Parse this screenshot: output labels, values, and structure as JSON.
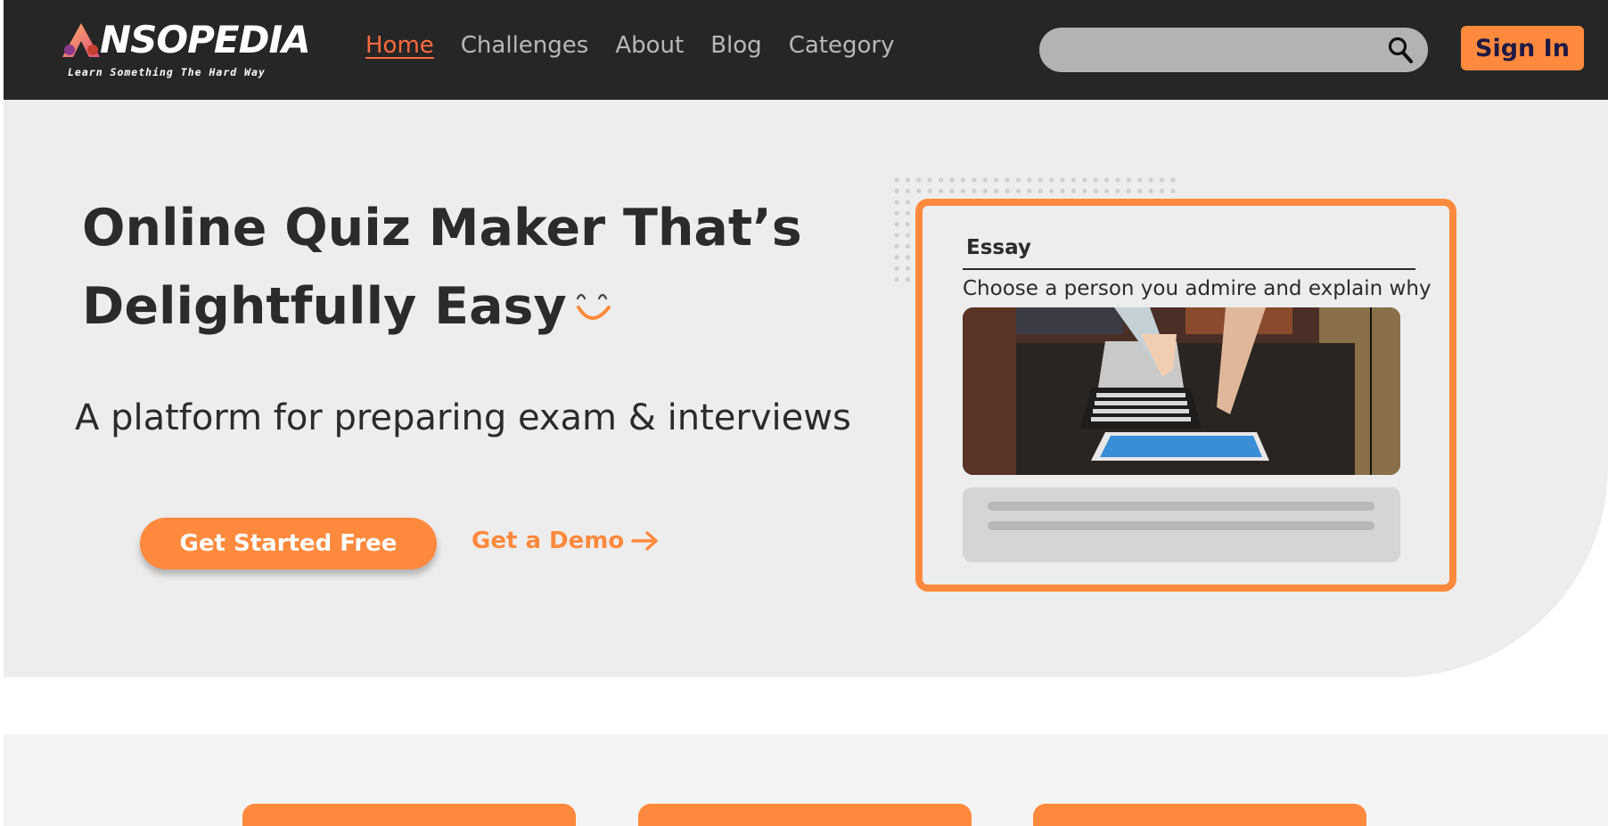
{
  "brand": {
    "name": "NSOPEDIA",
    "tagline": "Learn Something The Hard Way",
    "accent": "#ff8a3d",
    "nav_dark": "#262626"
  },
  "nav": {
    "links": [
      {
        "label": "Home",
        "active": true
      },
      {
        "label": "Challenges",
        "active": false
      },
      {
        "label": "About",
        "active": false
      },
      {
        "label": "Blog",
        "active": false
      },
      {
        "label": "Category",
        "active": false
      }
    ],
    "search": {
      "placeholder": "",
      "value": "",
      "icon": "search-icon"
    },
    "signin_label": "Sign In"
  },
  "hero": {
    "title_line1": "Online Quiz Maker That’s",
    "title_line2": "Delightfully Easy",
    "subtitle": "A platform for preparing exam & interviews",
    "cta_primary": "Get Started Free",
    "cta_secondary": "Get a Demo",
    "icons": [
      "smile-icon",
      "arrow-right-icon"
    ]
  },
  "quiz_card": {
    "heading": "Essay",
    "question": "Choose a person you admire and explain why",
    "image": "laptop-photo"
  }
}
